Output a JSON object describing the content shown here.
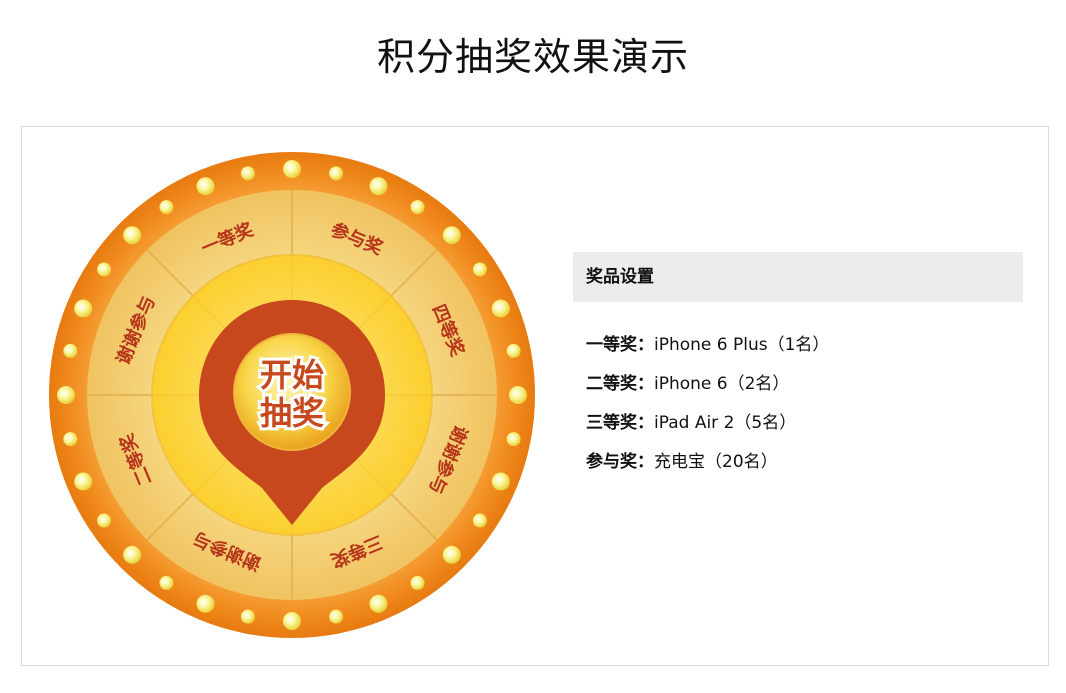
{
  "page": {
    "title": "积分抽奖效果演示"
  },
  "wheel": {
    "start_button": {
      "line1": "开始",
      "line2": "抽奖"
    },
    "sectors": [
      {
        "label": "参与奖"
      },
      {
        "label": "四等奖"
      },
      {
        "label": "谢谢参与"
      },
      {
        "label": "三等奖"
      },
      {
        "label": "谢谢参与"
      },
      {
        "label": "二等奖"
      },
      {
        "label": "谢谢参与"
      },
      {
        "label": "一等奖"
      }
    ],
    "colors": {
      "outer_ring": "#f08a1c",
      "sector_light": "#f7d884",
      "sector_mid": "#f2c768",
      "inner_disc": "#fcd73a",
      "pointer": "#c7481c",
      "label": "#b5341a",
      "bulb": "#fff59a"
    }
  },
  "prizes": {
    "header": "奖品设置",
    "separator": "：",
    "items": [
      {
        "level": "一等奖",
        "prize": "iPhone 6 Plus（1名）"
      },
      {
        "level": "二等奖",
        "prize": "iPhone 6（2名）"
      },
      {
        "level": "三等奖",
        "prize": "iPad Air 2（5名）"
      },
      {
        "level": "参与奖",
        "prize": "充电宝（20名）"
      }
    ]
  }
}
